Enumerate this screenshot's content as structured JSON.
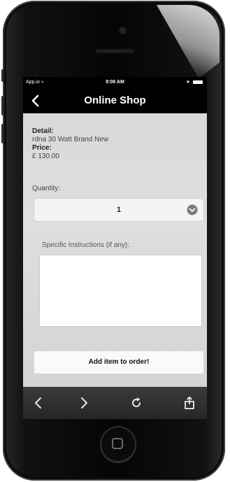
{
  "status_bar": {
    "carrier": "App.io",
    "time": "8:06 AM"
  },
  "nav": {
    "title": "Online Shop",
    "back_icon": "chevron-left-icon"
  },
  "product": {
    "detail_label": "Detail:",
    "detail_value": "rdna 30 Watt Brand New",
    "price_label": "Price:",
    "price_value": "£ 130.00"
  },
  "quantity": {
    "label": "Quantity:",
    "value": "1",
    "chevron_icon": "chevron-down-circle-icon"
  },
  "instructions": {
    "label": "Specific Instructions (if any):",
    "value": ""
  },
  "order_button": {
    "label": "Add item to order!"
  },
  "toolbar": {
    "items": [
      "back-arrow-icon",
      "forward-arrow-icon",
      "refresh-icon",
      "share-icon"
    ]
  },
  "colors": {
    "nav_bg": "#000000",
    "content_bg": "#dcdcdc",
    "toolbar_bg": "#2e2e2e"
  }
}
